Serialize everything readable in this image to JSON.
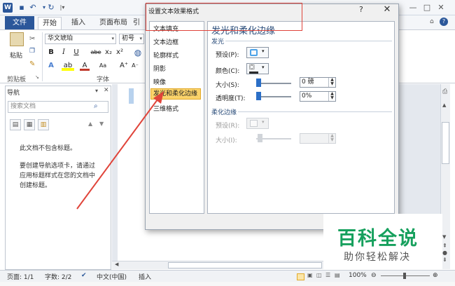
{
  "word": {
    "tabs": {
      "file": "文件",
      "home": "开始",
      "insert": "插入",
      "layout": "页面布局",
      "references": "引"
    },
    "clipboard": {
      "paste": "粘贴",
      "group": "剪贴板"
    },
    "font": {
      "name": "华文琥珀",
      "size": "初号",
      "group": "字体",
      "bold": "B",
      "italic": "I",
      "underline": "U",
      "strike": "abe",
      "sub": "x₂",
      "sup": "x²",
      "grow": "A⁺",
      "shrink": "A⁻",
      "case": "Aa",
      "effects": "A",
      "highlight": "ab",
      "color": "A"
    },
    "nav": {
      "title": "导航",
      "search_placeholder": "搜索文档",
      "empty_msg": "此文档不包含标题。",
      "hint_line1": "要创建导航选项卡，请通过",
      "hint_line2": "应用标题样式在您的文档中",
      "hint_line3": "创建标题。"
    },
    "status": {
      "page": "页面: 1/1",
      "words": "字数: 2/2",
      "lang": "中文(中国)",
      "mode": "插入",
      "zoom": "100%"
    }
  },
  "dialog": {
    "title": "设置文本效果格式",
    "help": "?",
    "close": "✕",
    "side_items": [
      "文本填充",
      "文本边框",
      "轮廓样式",
      "阴影",
      "映像",
      "发光和柔化边缘",
      "三维格式"
    ],
    "selected_index": 5,
    "panel": {
      "heading": "发光和柔化边缘",
      "glow": {
        "section": "发光",
        "preset": "预设(P):",
        "color": "颜色(C):",
        "size": "大小(S):",
        "size_value": "0 磅",
        "transparency": "透明度(T):",
        "transparency_value": "0%",
        "size_level": 0,
        "transparency_level": 0
      },
      "soft": {
        "section": "柔化边缘",
        "preset": "预设(R):",
        "size": "大小(I):",
        "size_value": ""
      }
    }
  },
  "watermark": {
    "main": "百科全说",
    "sub": "助你轻松解决"
  },
  "colors": {
    "word_blue": "#2b579a",
    "selected": "#fbd36a",
    "annotation_red": "#e0443a",
    "watermark_green": "#16a05d"
  }
}
